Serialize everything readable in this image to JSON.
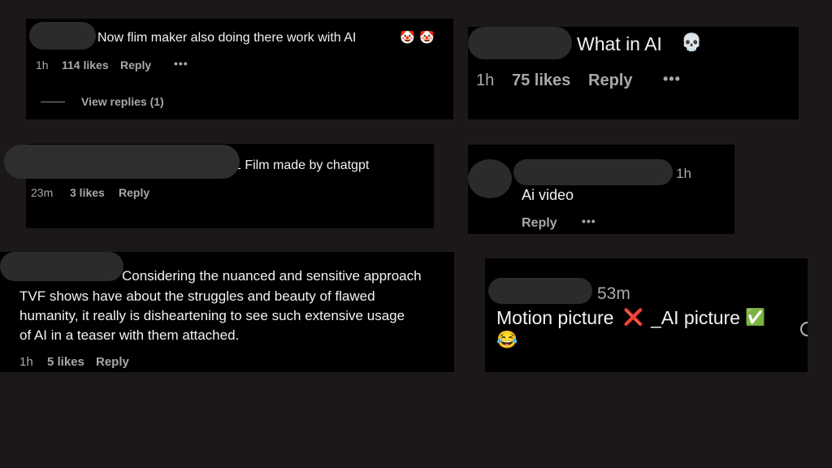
{
  "comments": [
    {
      "text": "Now flim maker also doing there work with AI",
      "emoji": [
        "🤡",
        "🤡"
      ],
      "time": "1h",
      "likes": "114 likes",
      "reply": "Reply",
      "more": "•••",
      "view_replies": "View replies (1)"
    },
    {
      "text": "What in AI",
      "emoji": "💀",
      "time": "1h",
      "likes": "75 likes",
      "reply": "Reply",
      "more": "•••"
    },
    {
      "text": "1 Film made by chatgpt",
      "time": "23m",
      "likes": "3 likes",
      "reply": "Reply"
    },
    {
      "time": "1h",
      "text": "Ai video",
      "reply": "Reply",
      "more": "•••"
    },
    {
      "lines": [
        "Considering the nuanced and sensitive approach",
        "TVF shows have about the struggles and beauty of flawed",
        "humanity, it really is disheartening to see such extensive usage",
        "of AI in a teaser with them attached."
      ],
      "time": "1h",
      "likes": "5 likes",
      "reply": "Reply"
    },
    {
      "time": "53m",
      "text_a": "Motion picture",
      "cross": "❌",
      "text_b": "_AI picture",
      "check": "✅",
      "emoji": "😂"
    }
  ]
}
